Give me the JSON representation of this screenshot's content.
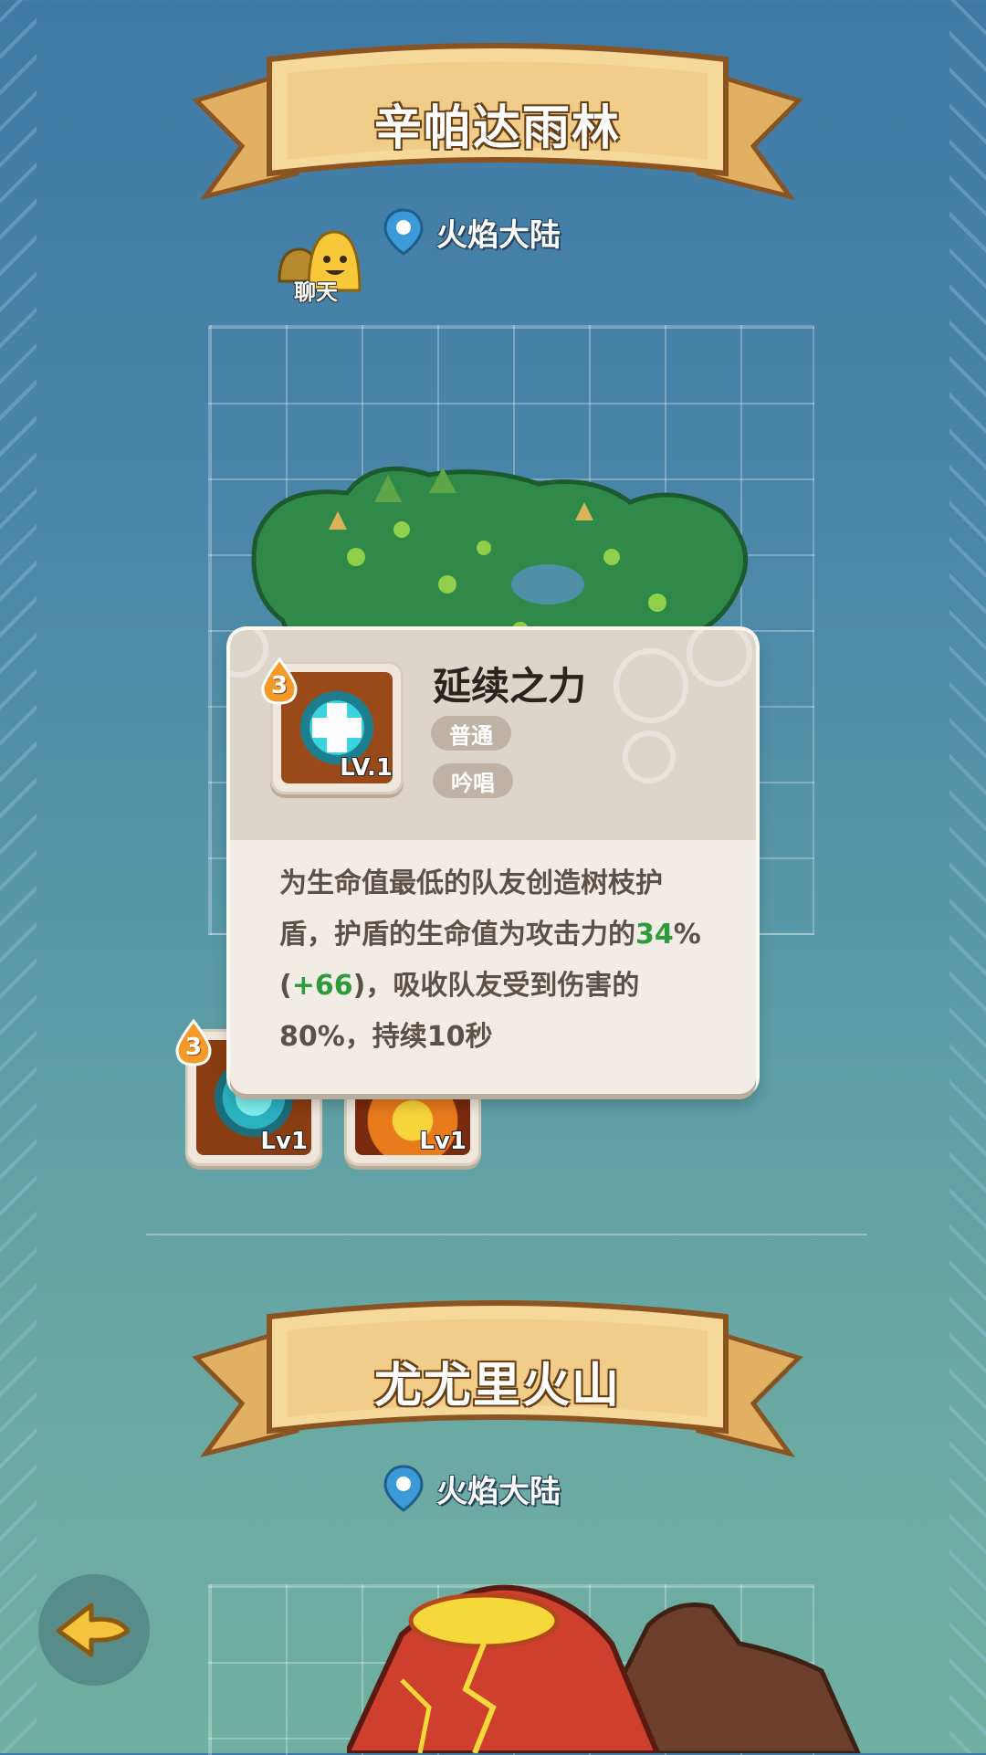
{
  "regions": [
    {
      "title": "辛帕达雨林",
      "location": "火焰大陆"
    },
    {
      "title": "尤尤里火山",
      "location": "火焰大陆"
    }
  ],
  "chat": {
    "label": "聊天"
  },
  "skill_popup": {
    "name": "延续之力",
    "level": "LV.1",
    "cost": "3",
    "tags": [
      "普通",
      "吟唱"
    ],
    "desc_part1": "为生命值最低的队友创造树枝护盾，护盾的生命值为攻击力的",
    "desc_value": "34",
    "desc_pct": "%(",
    "desc_bonus": "+66",
    "desc_part2": ")，吸收队友受到伤害的80%，持续10秒"
  },
  "skills": [
    {
      "level": "Lv1",
      "cost": "3"
    },
    {
      "level": "Lv1"
    }
  ],
  "icons": {
    "location": "map-pin-icon",
    "back": "back-arrow-icon",
    "chat": "chat-slime-icon"
  },
  "colors": {
    "ribbon": "#f1cd8a",
    "ribbon_edge": "#8a5322",
    "accent_green": "#2e9b3a",
    "badge": "#f39a2a"
  }
}
